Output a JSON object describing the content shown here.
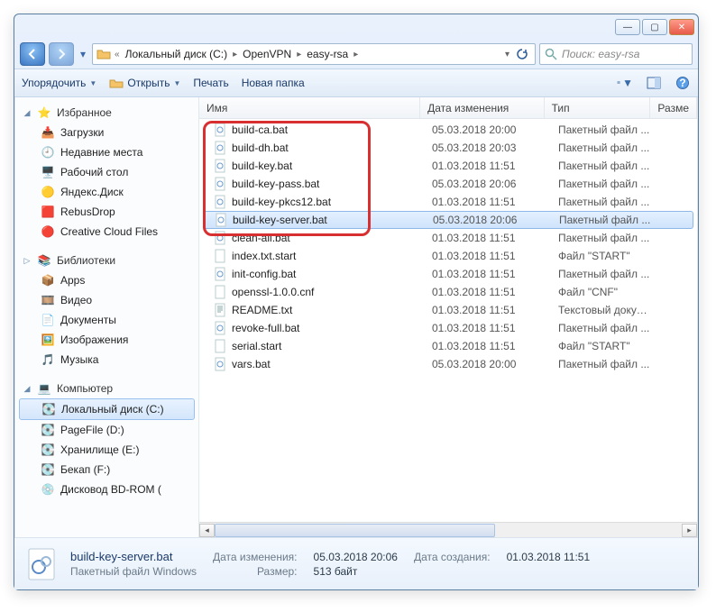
{
  "window": {
    "min": "—",
    "max": "▢",
    "close": "✕"
  },
  "breadcrumb": {
    "items": [
      "Локальный диск (C:)",
      "OpenVPN",
      "easy-rsa"
    ],
    "chev": "«"
  },
  "search": {
    "placeholder": "Поиск: easy-rsa"
  },
  "toolbar": {
    "organize": "Упорядочить",
    "open": "Открыть",
    "print": "Печать",
    "new_folder": "Новая папка"
  },
  "columns": {
    "name": "Имя",
    "date": "Дата изменения",
    "type": "Тип",
    "size": "Разме"
  },
  "sidebar": {
    "fav": "Избранное",
    "fav_items": [
      "Загрузки",
      "Недавние места",
      "Рабочий стол",
      "Яндекс.Диск",
      "RebusDrop",
      "Creative Cloud Files"
    ],
    "lib": "Библиотеки",
    "lib_items": [
      "Apps",
      "Видео",
      "Документы",
      "Изображения",
      "Музыка"
    ],
    "comp": "Компьютер",
    "comp_items": [
      "Локальный диск (C:)",
      "PageFile (D:)",
      "Хранилище (E:)",
      "Бекап (F:)",
      "Дисковод BD-ROM ("
    ]
  },
  "files": [
    {
      "name": "build-ca.bat",
      "date": "05.03.2018 20:00",
      "type": "Пакетный файл ...",
      "icon": "bat"
    },
    {
      "name": "build-dh.bat",
      "date": "05.03.2018 20:03",
      "type": "Пакетный файл ...",
      "icon": "bat"
    },
    {
      "name": "build-key.bat",
      "date": "01.03.2018 11:51",
      "type": "Пакетный файл ...",
      "icon": "bat"
    },
    {
      "name": "build-key-pass.bat",
      "date": "05.03.2018 20:06",
      "type": "Пакетный файл ...",
      "icon": "bat"
    },
    {
      "name": "build-key-pkcs12.bat",
      "date": "01.03.2018 11:51",
      "type": "Пакетный файл ...",
      "icon": "bat"
    },
    {
      "name": "build-key-server.bat",
      "date": "05.03.2018 20:06",
      "type": "Пакетный файл ...",
      "icon": "bat",
      "selected": true
    },
    {
      "name": "clean-all.bat",
      "date": "01.03.2018 11:51",
      "type": "Пакетный файл ...",
      "icon": "bat"
    },
    {
      "name": "index.txt.start",
      "date": "01.03.2018 11:51",
      "type": "Файл \"START\"",
      "icon": "blank"
    },
    {
      "name": "init-config.bat",
      "date": "01.03.2018 11:51",
      "type": "Пакетный файл ...",
      "icon": "bat"
    },
    {
      "name": "openssl-1.0.0.cnf",
      "date": "01.03.2018 11:51",
      "type": "Файл \"CNF\"",
      "icon": "blank"
    },
    {
      "name": "README.txt",
      "date": "01.03.2018 11:51",
      "type": "Текстовый докум...",
      "icon": "txt"
    },
    {
      "name": "revoke-full.bat",
      "date": "01.03.2018 11:51",
      "type": "Пакетный файл ...",
      "icon": "bat"
    },
    {
      "name": "serial.start",
      "date": "01.03.2018 11:51",
      "type": "Файл \"START\"",
      "icon": "blank"
    },
    {
      "name": "vars.bat",
      "date": "05.03.2018 20:00",
      "type": "Пакетный файл ...",
      "icon": "bat"
    }
  ],
  "details": {
    "name": "build-key-server.bat",
    "sub": "Пакетный файл Windows",
    "mod_label": "Дата изменения:",
    "mod": "05.03.2018 20:06",
    "size_label": "Размер:",
    "size": "513 байт",
    "created_label": "Дата создания:",
    "created": "01.03.2018 11:51"
  }
}
